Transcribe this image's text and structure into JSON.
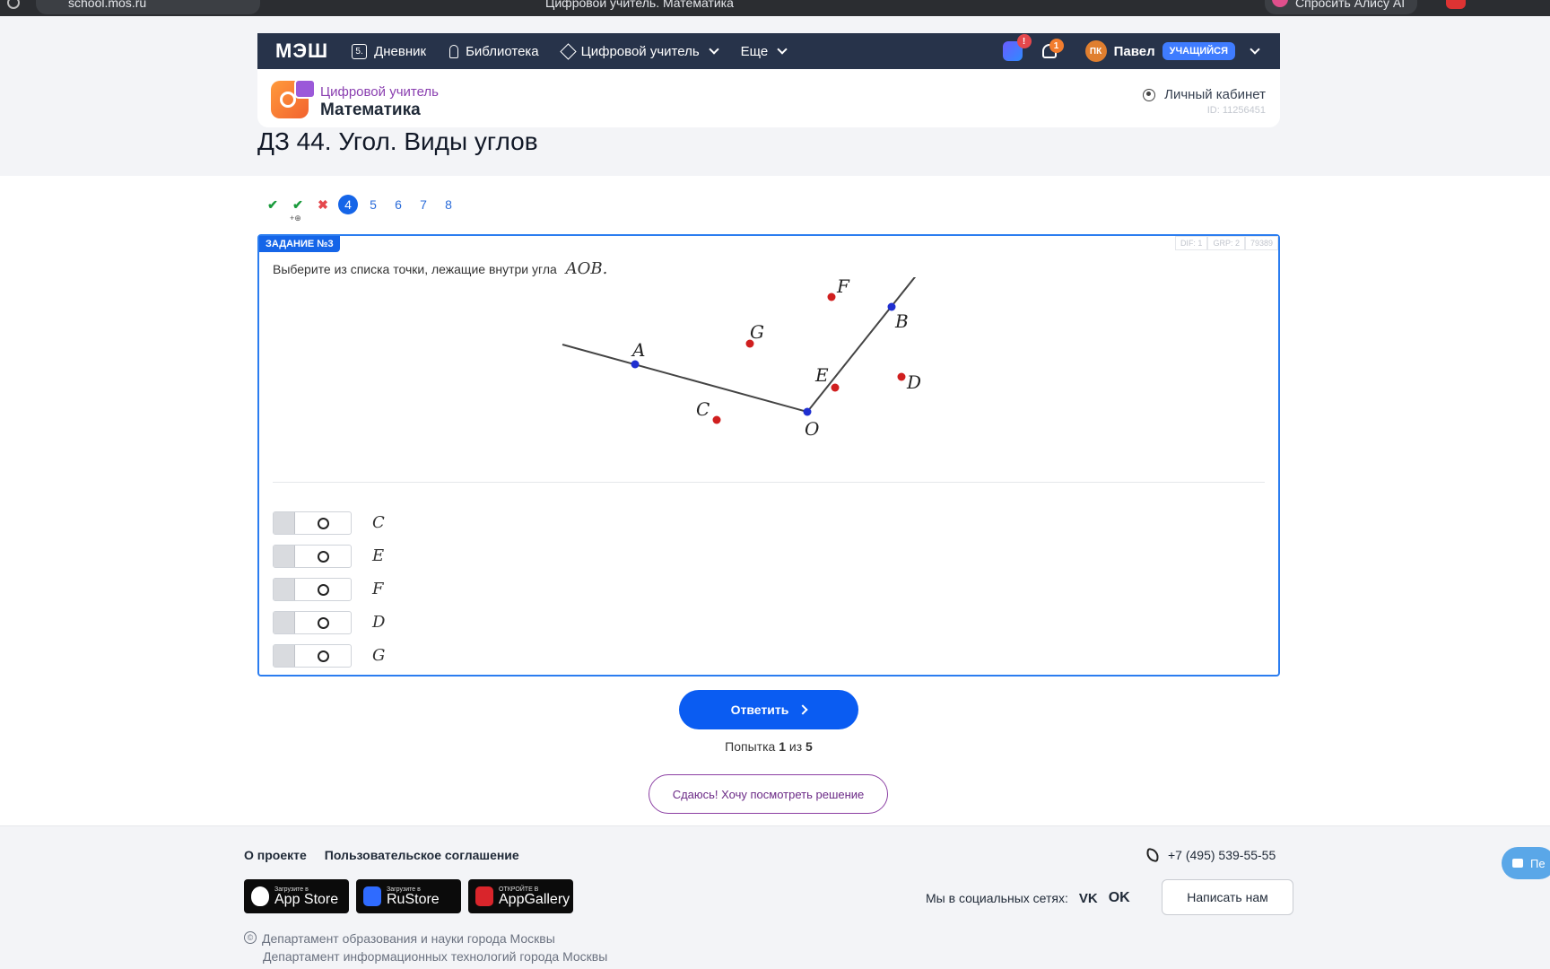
{
  "browser": {
    "url": "school.mos.ru",
    "tab_title": "Цифровой учитель. Математика",
    "alice": "Спросить Алису AI"
  },
  "nav": {
    "logo": "МЭШ",
    "diary_icon_text": "5.",
    "diary": "Дневник",
    "library": "Библиотека",
    "teacher": "Цифровой учитель",
    "more": "Еще",
    "app_badge": "!",
    "bell_badge": "1",
    "avatar": "ПК",
    "user": "Павел",
    "role": "УЧАЩИЙСЯ"
  },
  "subheader": {
    "brand_sub": "Цифровой учитель",
    "brand_main": "Математика",
    "cabinet": "Личный кабинет",
    "id": "ID: 11256451"
  },
  "page": {
    "title": "ДЗ 44. Угол. Виды углов"
  },
  "qnav": {
    "items": [
      "✔",
      "✔",
      "✖",
      "4",
      "5",
      "6",
      "7",
      "8"
    ],
    "sub_mark": "+⊕"
  },
  "task": {
    "tag": "ЗАДАНИЕ №3",
    "meta": [
      "DIF: 1",
      "GRP: 2",
      "79389"
    ],
    "prompt": "Выберите из списка точки, лежащие внутри угла",
    "prompt_math": "AOB.",
    "figure": {
      "labels": {
        "A": "A",
        "B": "B",
        "O": "O",
        "C": "C",
        "D": "D",
        "E": "E",
        "F": "F",
        "G": "G"
      },
      "ray_color": "#444444",
      "vertex_color": "#1f2fd0",
      "point_color": "#d01f1f"
    },
    "options": [
      "C",
      "E",
      "F",
      "D",
      "G"
    ]
  },
  "actions": {
    "answer": "Ответить",
    "attempt_prefix": "Попытка",
    "attempt_current": "1",
    "attempt_mid": "из",
    "attempt_total": "5",
    "give_up": "Сдаюсь! Хочу посмотреть решение"
  },
  "footer": {
    "about": "О проекте",
    "agreement": "Пользовательское соглашение",
    "phone": "+7 (495) 539-55-55",
    "stores": [
      {
        "small": "Загрузите в",
        "big": "App Store"
      },
      {
        "small": "Загрузите в",
        "big": "RuStore"
      },
      {
        "small": "ОТКРОЙТЕ В",
        "big": "AppGallery"
      }
    ],
    "social_label": "Мы в социальных сетях:",
    "vk": "VK",
    "ok": "OK",
    "write": "Написать нам",
    "copyright": "©",
    "dept1": "Департамент образования и науки города Москвы",
    "dept2": "Департамент информационных технологий города Москвы",
    "chat": "Пе"
  }
}
